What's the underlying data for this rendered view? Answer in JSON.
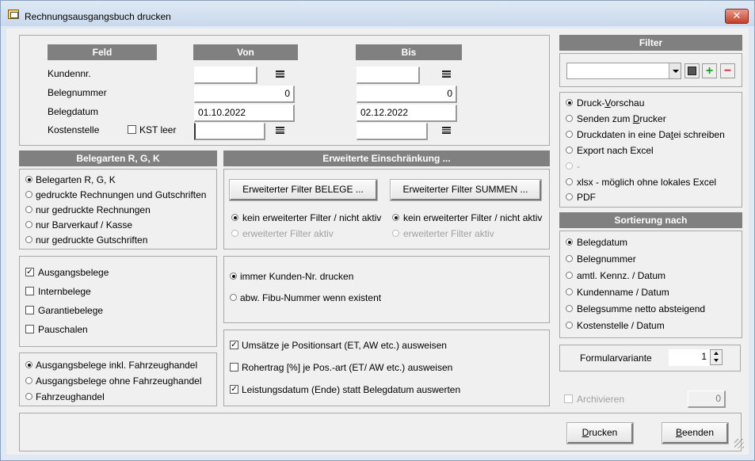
{
  "window": {
    "title": "Rechnungsausgangsbuch drucken",
    "close": "✕"
  },
  "criteria": {
    "header_feld": "Feld",
    "header_von": "Von",
    "header_bis": "Bis",
    "rows": [
      {
        "label": "Kundennr.",
        "von": "",
        "bis": ""
      },
      {
        "label": "Belegnummer",
        "von": "0",
        "bis": "0"
      },
      {
        "label": "Belegdatum",
        "von": "01.10.2022",
        "bis": "02.12.2022"
      },
      {
        "label": "Kostenstelle",
        "von": "",
        "bis": ""
      }
    ],
    "kst_leer": "KST leer"
  },
  "belegarten": {
    "header": "Belegarten R, G, K",
    "options": [
      "Belegarten R, G, K",
      "gedruckte Rechnungen und Gutschriften",
      "nur gedruckte Rechnungen",
      "nur Barverkauf / Kasse",
      "nur gedruckte Gutschriften"
    ]
  },
  "belege": {
    "items": [
      "Ausgangsbelege",
      "Internbelege",
      "Garantiebelege",
      "Pauschalen"
    ]
  },
  "fahrzeug": {
    "options": [
      "Ausgangsbelege inkl. Fahrzeughandel",
      "Ausgangsbelege ohne Fahrzeughandel",
      "Fahrzeughandel"
    ]
  },
  "erweitert": {
    "header": "Erweiterte Einschränkung ...",
    "btn_belege": "Erweiterter Filter BELEGE ...",
    "btn_summen": "Erweiterter Filter SUMMEN ...",
    "kein": "kein erweiterter Filter / nicht aktiv",
    "aktiv": "erweiterter Filter aktiv"
  },
  "kunden": {
    "immer": "immer Kunden-Nr. drucken",
    "abw": "abw. Fibu-Nummer wenn existent"
  },
  "umsatz": {
    "items": [
      "Umsätze  je Positionsart (ET, AW etc.) ausweisen",
      "Rohertrag [%]  je Pos.-art (ET/ AW etc.) ausweisen",
      "Leistungsdatum (Ende) statt Belegdatum auswerten"
    ]
  },
  "filter": {
    "header": "Filter",
    "value": ""
  },
  "ausgabe": {
    "options": [
      {
        "pre": "Druck-",
        "u": "V",
        "post": "orschau"
      },
      {
        "pre": "Senden zum ",
        "u": "D",
        "post": "rucker"
      },
      {
        "pre": "Druckdaten in eine Da",
        "u": "t",
        "post": "ei schreiben"
      },
      {
        "pre": "Export nach Excel",
        "u": "",
        "post": ""
      },
      {
        "pre": "-",
        "u": "",
        "post": ""
      },
      {
        "pre": "xlsx - möglich ohne lokales Excel",
        "u": "",
        "post": ""
      },
      {
        "pre": "PDF",
        "u": "",
        "post": ""
      }
    ]
  },
  "sortierung": {
    "header": "Sortierung nach",
    "options": [
      "Belegdatum",
      "Belegnummer",
      "amtl. Kennz. / Datum",
      "Kundenname / Datum",
      "Belegsumme netto absteigend",
      "Kostenstelle / Datum"
    ]
  },
  "formular": {
    "label": "Formularvariante",
    "value": "1"
  },
  "archiv": {
    "label": "Archivieren",
    "value": "0"
  },
  "actions": {
    "drucken_u": "D",
    "drucken_rest": "rucken",
    "beenden_u": "B",
    "beenden_rest": "eenden"
  }
}
